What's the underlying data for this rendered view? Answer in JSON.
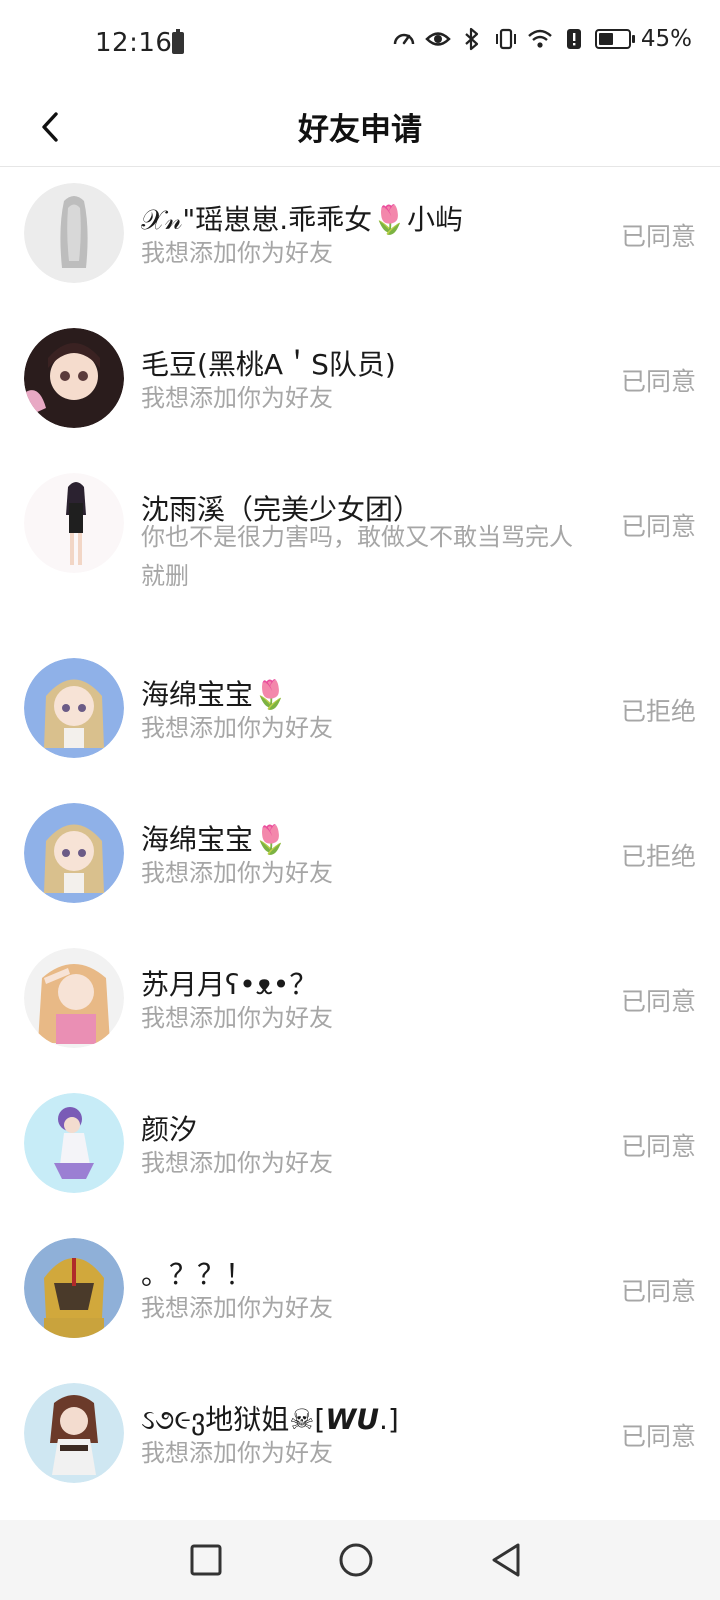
{
  "status_bar": {
    "time": "12:16",
    "battery_percent": "45%",
    "icons": [
      "speed-icon",
      "eye-icon",
      "bluetooth-icon",
      "vibrate-icon",
      "wifi-icon",
      "alert-icon",
      "battery-icon"
    ]
  },
  "header": {
    "title": "好友申请",
    "back_icon": "chevron-left-icon"
  },
  "requests": [
    {
      "name": "𝒳𝓃\"瑶崽崽.乖乖女🌷小屿",
      "message": "我想添加你为好友",
      "status": "已同意",
      "avatar": "avatar-silver-hair"
    },
    {
      "name": "毛豆(黑桃A＇S队员)",
      "message": "我想添加你为好友",
      "status": "已同意",
      "avatar": "avatar-dark-hair-girl"
    },
    {
      "name": "沈雨溪（完美少女团）",
      "message": "你也不是很力害吗，敢做又不敢当骂完人就删",
      "status": "已同意",
      "avatar": "avatar-black-outfit-girl"
    },
    {
      "name": "海绵宝宝🌷",
      "message": "我想添加你为好友",
      "status": "已拒绝",
      "avatar": "avatar-braided-blonde"
    },
    {
      "name": "海绵宝宝🌷",
      "message": "我想添加你为好友",
      "status": "已拒绝",
      "avatar": "avatar-braided-blonde"
    },
    {
      "name": "苏月月ʕ•ᴥ•？",
      "message": "我想添加你为好友",
      "status": "已同意",
      "avatar": "avatar-salute-blonde"
    },
    {
      "name": "颜汐",
      "message": "我想添加你为好友",
      "status": "已同意",
      "avatar": "avatar-purple-hair"
    },
    {
      "name": "。？？！",
      "message": "我想添加你为好友",
      "status": "已同意",
      "avatar": "avatar-gold-helmet"
    },
    {
      "name": "ઽ૭૯ვ地狱姐☠[𝙒𝙐.]",
      "message": "我想添加你为好友",
      "status": "已同意",
      "avatar": "avatar-brown-hair-girl"
    }
  ],
  "colors": {
    "accent_text": "#1a1a1a",
    "secondary_text": "#a6a6a6",
    "divider": "#e6e6e6",
    "nav_background": "#f5f5f5"
  },
  "nav_bar": {
    "buttons": [
      "recent-apps-icon",
      "home-icon",
      "back-triangle-icon"
    ]
  }
}
